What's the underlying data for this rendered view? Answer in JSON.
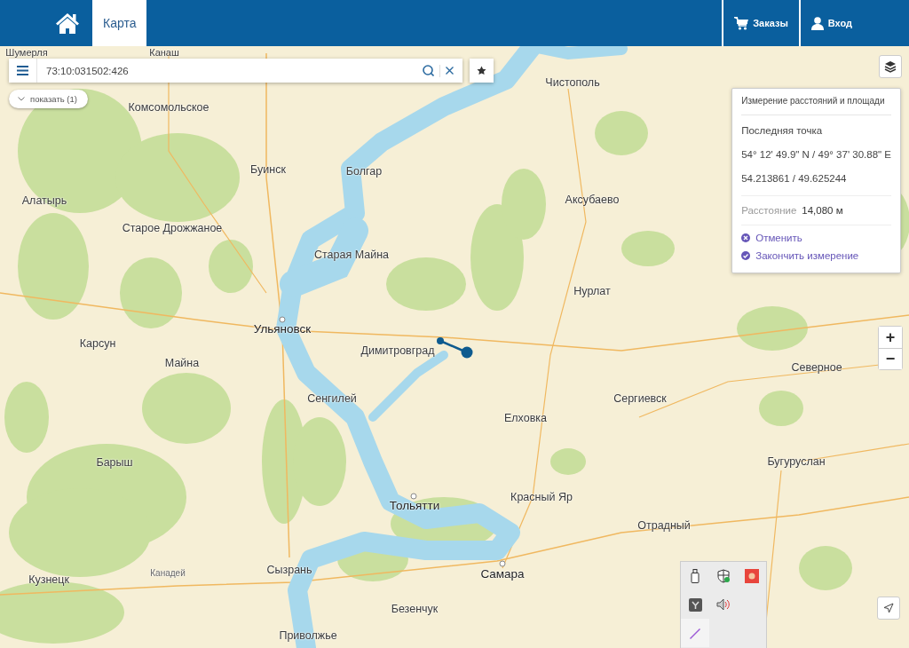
{
  "header": {
    "tabs": [
      {
        "label": "Карта",
        "selected": true
      }
    ],
    "actions": [
      {
        "label": "Заказы",
        "kind": "cart"
      },
      {
        "label": "Вход",
        "kind": "user"
      }
    ]
  },
  "search": {
    "value": "73:10:031502:426"
  },
  "results_toggle": {
    "label": "показать (1)"
  },
  "map": {
    "places": [
      {
        "name": "Шумерля",
        "kind": "town"
      },
      {
        "name": "Канаш",
        "kind": "town"
      },
      {
        "name": "Комсомольское",
        "kind": "town"
      },
      {
        "name": "Буинск",
        "kind": "town"
      },
      {
        "name": "Болгар",
        "kind": "town"
      },
      {
        "name": "Алатырь",
        "kind": "town"
      },
      {
        "name": "Старое Дрожжаное",
        "kind": "town"
      },
      {
        "name": "Старая Майна",
        "kind": "town"
      },
      {
        "name": "Ульяновск",
        "kind": "city"
      },
      {
        "name": "Карсун",
        "kind": "town"
      },
      {
        "name": "Майна",
        "kind": "town"
      },
      {
        "name": "Димитровград",
        "kind": "town"
      },
      {
        "name": "Сенгилей",
        "kind": "town"
      },
      {
        "name": "Барыш",
        "kind": "town"
      },
      {
        "name": "Тольятти",
        "kind": "city"
      },
      {
        "name": "Кузнецк",
        "kind": "town"
      },
      {
        "name": "Канадей",
        "kind": "village"
      },
      {
        "name": "Сызрань",
        "kind": "town"
      },
      {
        "name": "Безенчук",
        "kind": "town"
      },
      {
        "name": "Приволжье",
        "kind": "town"
      },
      {
        "name": "Чистополь",
        "kind": "town"
      },
      {
        "name": "Аксубаево",
        "kind": "town"
      },
      {
        "name": "Нурлат",
        "kind": "town"
      },
      {
        "name": "Сергиевск",
        "kind": "town"
      },
      {
        "name": "Елховка",
        "kind": "town"
      },
      {
        "name": "Северное",
        "kind": "town"
      },
      {
        "name": "Бугуруслан",
        "kind": "town"
      },
      {
        "name": "Красный Яр",
        "kind": "town"
      },
      {
        "name": "Отрадный",
        "kind": "town"
      },
      {
        "name": "Самара",
        "kind": "city"
      }
    ]
  },
  "measure_panel": {
    "title": "Измерение расстояний и площади",
    "last_point_label": "Последняя точка",
    "dms": "54° 12' 49.9\" N / 49° 37' 30.88\" E",
    "decimal": "54.213861 / 49.625244",
    "distance_label": "Расстояние",
    "distance": "14,080 м",
    "actions": [
      {
        "label": "Отменить",
        "kind": "cancel"
      },
      {
        "label": "Закончить измерение",
        "kind": "finish"
      }
    ]
  },
  "zoom": {
    "in": "+",
    "out": "−"
  }
}
